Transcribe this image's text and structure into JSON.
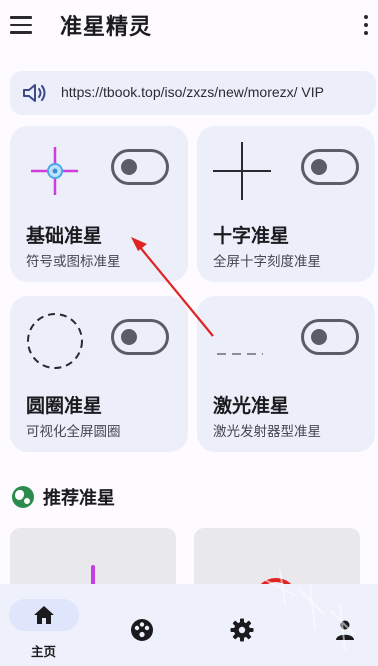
{
  "app": {
    "title": "准星精灵",
    "menu_icon": "hamburger-menu-icon",
    "more_icon": "more-vertical-icon"
  },
  "notice": {
    "icon": "speaker-icon",
    "text": "https://tbook.top/iso/zxzs/new/morezx/ VIP"
  },
  "cards": [
    {
      "title": "基础准星",
      "desc": "符号或图标准星",
      "visual": "basic-crosshair-icon",
      "toggle_on": false,
      "accent": "#d03ce0"
    },
    {
      "title": "十字准星",
      "desc": "全屏十字刻度准星",
      "visual": "cross-crosshair-icon",
      "toggle_on": false
    },
    {
      "title": "圆圈准星",
      "desc": "可视化全屏圆圈",
      "visual": "dashed-circle-icon",
      "toggle_on": false
    },
    {
      "title": "激光准星",
      "desc": "激光发射器型准星",
      "visual": "dashed-line-icon",
      "toggle_on": false
    }
  ],
  "recommended": {
    "title": "推荐准星",
    "icon": "globe-icon",
    "icon_color": "#2e8b4e"
  },
  "bottom_nav": {
    "items": [
      {
        "label": "主页",
        "icon": "home-icon",
        "active": true
      },
      {
        "label": "",
        "icon": "palette-icon",
        "active": false
      },
      {
        "label": "",
        "icon": "settings-gear-icon",
        "active": false
      },
      {
        "label": "",
        "icon": "user-icon",
        "active": false
      }
    ]
  },
  "colors": {
    "background": "#fdfbff",
    "card": "#eceef9",
    "annotation_arrow": "#e02424",
    "nav_active": "#dfe6fb"
  }
}
